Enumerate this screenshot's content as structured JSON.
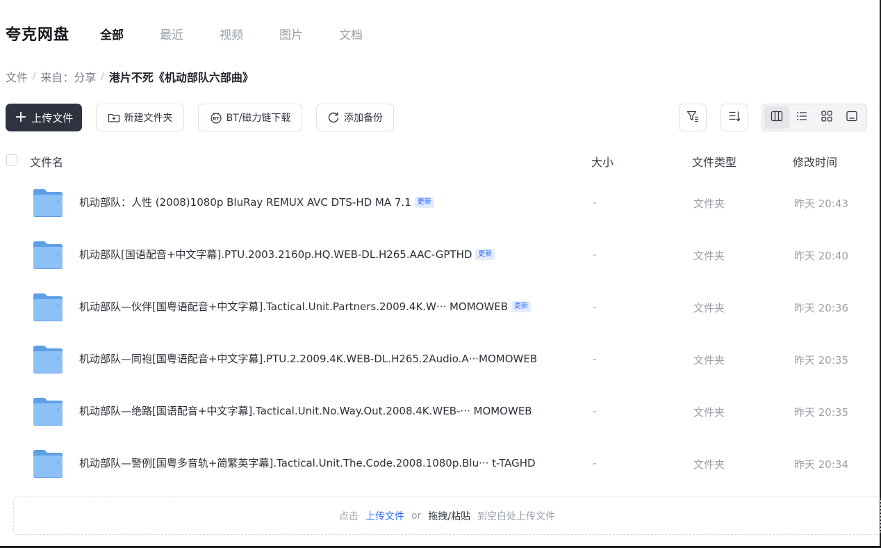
{
  "app": {
    "logo": "夸克网盘"
  },
  "nav": {
    "tabs": [
      {
        "label": "全部",
        "active": true
      },
      {
        "label": "最近"
      },
      {
        "label": "视频"
      },
      {
        "label": "图片"
      },
      {
        "label": "文档"
      }
    ]
  },
  "breadcrumb": {
    "items": [
      "文件",
      "来自：分享",
      "港片不死《机动部队六部曲》"
    ]
  },
  "toolbar": {
    "upload": "上传文件",
    "new_folder": "新建文件夹",
    "bt": "BT/磁力链下载",
    "backup": "添加备份",
    "icons": {
      "filter": "filter-icon",
      "sort": "sort-icon",
      "views": [
        "column-view-icon",
        "list-view-icon",
        "grid-view-icon",
        "preview-view-icon"
      ]
    }
  },
  "table": {
    "headers": {
      "name": "文件名",
      "size": "大小",
      "type": "文件类型",
      "modified": "修改时间"
    },
    "rows": [
      {
        "name": "机动部队：人性 (2008)1080p BluRay REMUX AVC DTS-HD MA 7.1",
        "badge": "更新",
        "size": "-",
        "type": "文件夹",
        "modified": "昨天 20:43"
      },
      {
        "name": "机动部队[国语配音+中文字幕].PTU.2003.2160p.HQ.WEB-DL.H265.AAC-GPTHD",
        "badge": "更新",
        "size": "-",
        "type": "文件夹",
        "modified": "昨天 20:40"
      },
      {
        "name": "机动部队—伙伴[国粤语配音+中文字幕].Tactical.Unit.Partners.2009.4K.W··· MOMOWEB",
        "badge": "更新",
        "size": "-",
        "type": "文件夹",
        "modified": "昨天 20:36"
      },
      {
        "name": "机动部队—同袍[国粤语配音+中文字幕].PTU.2.2009.4K.WEB-DL.H265.2Audio.A···MOMOWEB",
        "badge": "",
        "size": "-",
        "type": "文件夹",
        "modified": "昨天 20:35"
      },
      {
        "name": "机动部队—绝路[国语配音+中文字幕].Tactical.Unit.No.Way.Out.2008.4K.WEB-···  MOMOWEB",
        "badge": "",
        "size": "-",
        "type": "文件夹",
        "modified": "昨天 20:35"
      },
      {
        "name": "机动部队—警例[国粤多音轨+简繁英字幕].Tactical.Unit.The.Code.2008.1080p.Blu··· t-TAGHD",
        "badge": "",
        "size": "-",
        "type": "文件夹",
        "modified": "昨天 20:34"
      }
    ]
  },
  "dropzone": {
    "prefix": "点击",
    "link": "上传文件",
    "or": "or",
    "action": "拖拽/粘贴",
    "suffix": "到空白处上传文件"
  },
  "colors": {
    "accent": "#2f6bff",
    "primary_button": "#2f3340",
    "folder": "#7fb6f2"
  }
}
